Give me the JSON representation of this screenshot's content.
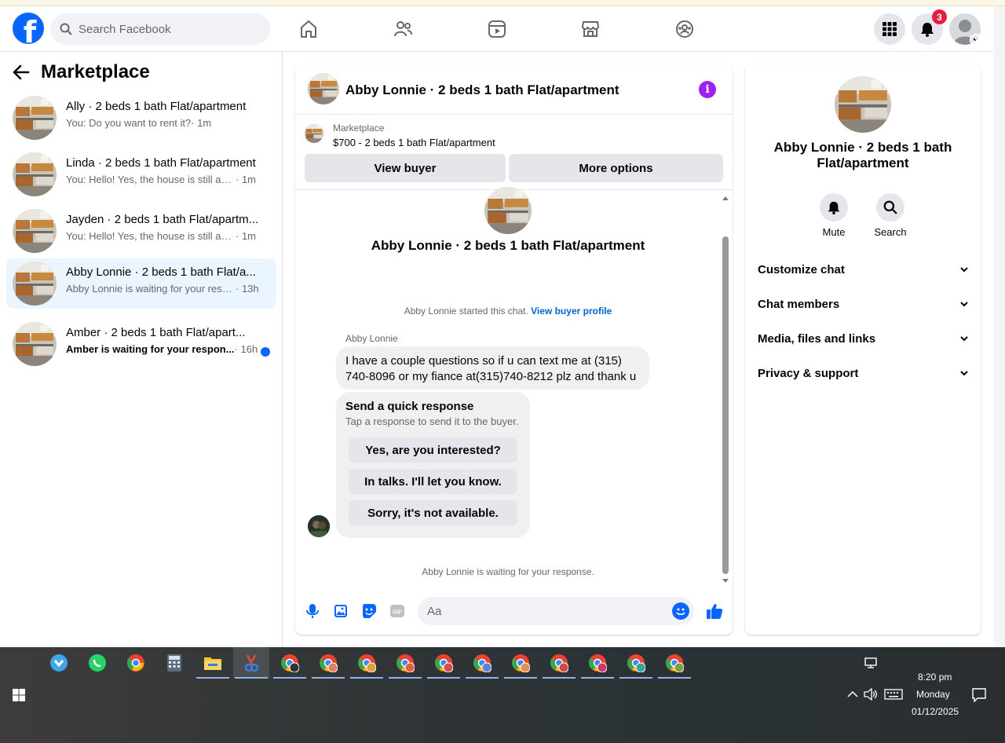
{
  "search": {
    "placeholder": "Search Facebook"
  },
  "notifications": {
    "count": "3"
  },
  "left": {
    "title": "Marketplace",
    "conversations": [
      {
        "title": "Ally · 2 beds 1 bath Flat/apartment",
        "preview": "You: Do you want to rent it?",
        "time": "· 1m"
      },
      {
        "title": "Linda · 2 beds 1 bath Flat/apartment",
        "preview": "You: Hello! Yes, the house is still avail...",
        "time": "· 1m"
      },
      {
        "title": "Jayden · 2 beds 1 bath Flat/apartm...",
        "preview": "You: Hello! Yes, the house is still avail...",
        "time": "· 1m"
      },
      {
        "title": "Abby Lonnie · 2 beds 1 bath Flat/a...",
        "preview": "Abby Lonnie is waiting for your resp...",
        "time": "· 13h"
      },
      {
        "title": "Amber · 2 beds 1 bath Flat/apart...",
        "preview": "Amber is waiting for your respon...",
        "time": "· 16h"
      }
    ]
  },
  "chat": {
    "title": "Abby Lonnie · 2 beds 1 bath Flat/apartment",
    "listing_label": "Marketplace",
    "listing_text": "$700 - 2 beds 1 bath Flat/apartment",
    "view_buyer": "View buyer",
    "more_options": "More options",
    "intro_title": "Abby Lonnie · 2 beds 1 bath Flat/apartment",
    "started_text": "Abby Lonnie started this chat.",
    "view_profile": "View buyer profile",
    "sender": "Abby Lonnie",
    "message": "I have a couple questions so if u can text me at (315) 740-8096 or my fiance at(315)740-8212 plz and thank u",
    "quick_title": "Send a quick response",
    "quick_sub": "Tap a response to send it to the buyer.",
    "quick_replies": [
      "Yes, are you interested?",
      "In talks. I'll let you know.",
      "Sorry, it's not available."
    ],
    "waiting": "Abby Lonnie is waiting for your response.",
    "input_placeholder": "Aa"
  },
  "info": {
    "title": "Abby Lonnie · 2 beds 1 bath Flat/apartment",
    "mute": "Mute",
    "search": "Search",
    "sections": [
      "Customize chat",
      "Chat members",
      "Media, files and links",
      "Privacy & support"
    ]
  },
  "taskbar": {
    "time": "8:20 pm",
    "day": "Monday",
    "date": "01/12/2025"
  },
  "colors": {
    "brand": "#0866ff",
    "info": "#a020f0",
    "badge": "#e41e3f"
  }
}
